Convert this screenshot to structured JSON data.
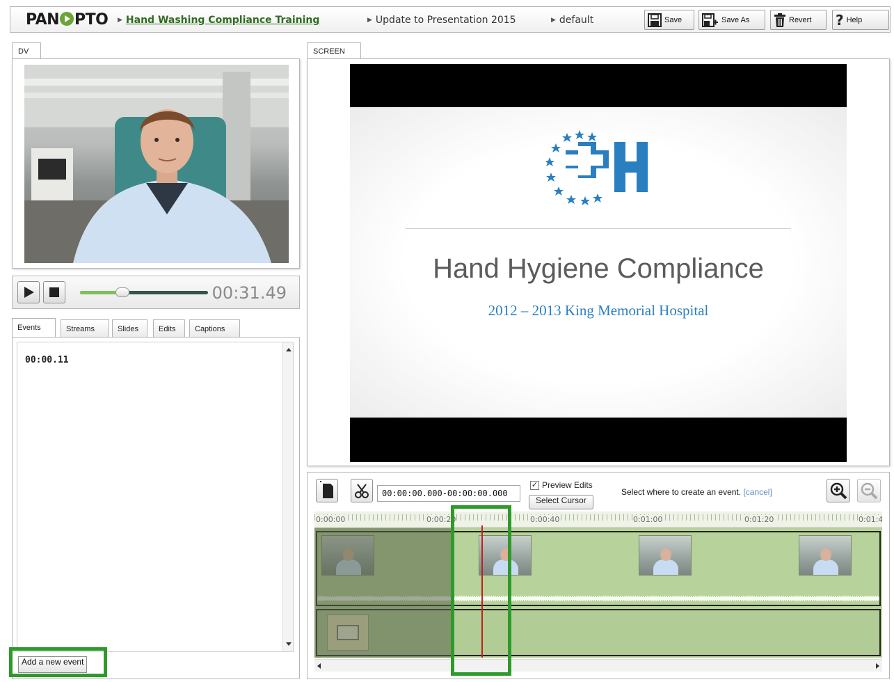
{
  "header": {
    "logo": "PAN PTO",
    "logo_left": "PAN",
    "logo_right": "PTO",
    "course": "Hand Washing Compliance Training",
    "session": "Update to Presentation 2015",
    "version": "default",
    "buttons": {
      "save": "Save",
      "save_as": "Save As",
      "revert": "Revert",
      "help": "Help"
    }
  },
  "dv": {
    "tab": "DV"
  },
  "player": {
    "time": "00:31.49",
    "progress": 0.33
  },
  "left_tabs": [
    "Events",
    "Streams",
    "Slides",
    "Edits",
    "Captions"
  ],
  "events": {
    "items": [
      {
        "time": "00:00.11"
      }
    ],
    "add_button": "Add a new event"
  },
  "screen": {
    "tab": "SCREEN",
    "slide_title": "Hand Hygiene Compliance",
    "slide_subtitle": "2012 – 2013 King Memorial Hospital"
  },
  "timeline": {
    "range": "00:00:00.000-00:00:00.000",
    "preview_edits_label": "Preview Edits",
    "preview_edits_checked": true,
    "select_cursor": "Select Cursor",
    "hint": "Select where to create an event.",
    "cancel": "[cancel]",
    "ticks": [
      "0:00:00",
      "0:00:20",
      "0:00:40",
      "0:01:00",
      "0:01:20",
      "0:01:4"
    ]
  },
  "colors": {
    "accent_green": "#2e9a2a",
    "link_blue": "#5f8ec4",
    "playhead": "#c0201e",
    "slide_blue": "#2a7fc1"
  }
}
